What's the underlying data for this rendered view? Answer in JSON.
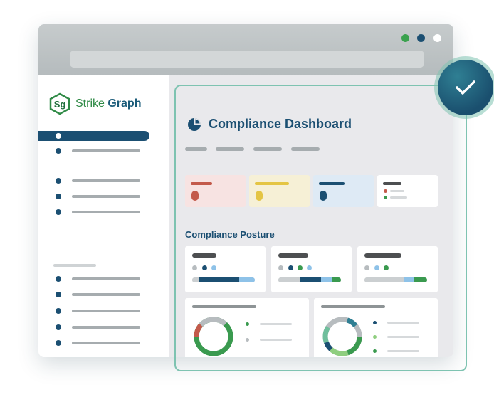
{
  "brand": {
    "logo_mark": "Sg",
    "name_part1": "Strike",
    "name_part2": "Graph",
    "primary_color": "#1b4f72",
    "accent_color": "#2f8a46"
  },
  "dashboard": {
    "title": "Compliance Dashboard",
    "title_icon": "pie-chart-icon"
  },
  "posture": {
    "title": "Compliance Posture"
  },
  "status": {
    "badge_icon": "checkmark-icon"
  }
}
